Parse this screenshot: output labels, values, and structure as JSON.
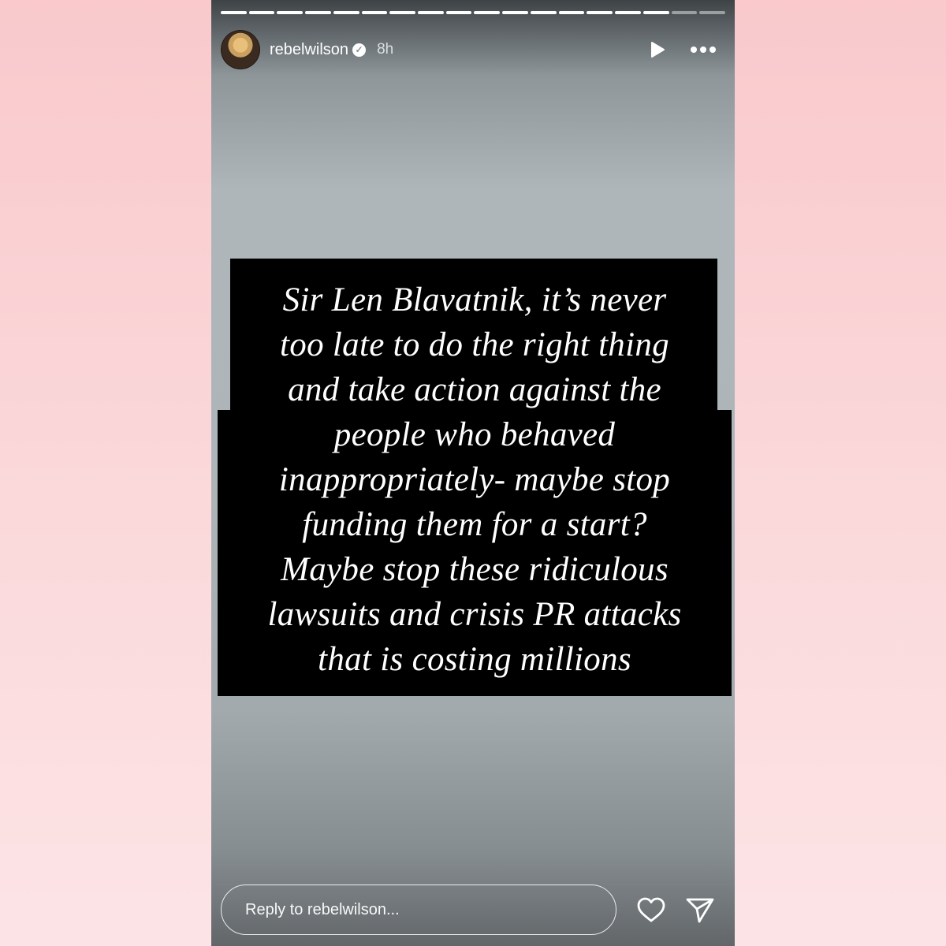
{
  "story": {
    "username": "rebelwilson",
    "time": "8h",
    "verified": true,
    "progress_segments_total": 18,
    "progress_segments_done": 16,
    "text_lines": [
      "Sir Len Blavatnik, it’s never",
      "too late to do the right thing",
      "and take action against the",
      "people who behaved",
      "inappropriately- maybe stop",
      "funding them for a start?",
      "Maybe stop these ridiculous",
      "lawsuits and crisis PR attacks",
      "that is costing millions"
    ]
  },
  "header_icons": [
    "avatar",
    "verified-badge-icon",
    "play-icon",
    "more-options-icon"
  ],
  "reply": {
    "placeholder": "Reply to rebelwilson..."
  },
  "footer_icons": [
    "heart-icon",
    "send-icon"
  ],
  "colors": {
    "text_card": "#000000",
    "page_background": "#f9c9cc"
  }
}
